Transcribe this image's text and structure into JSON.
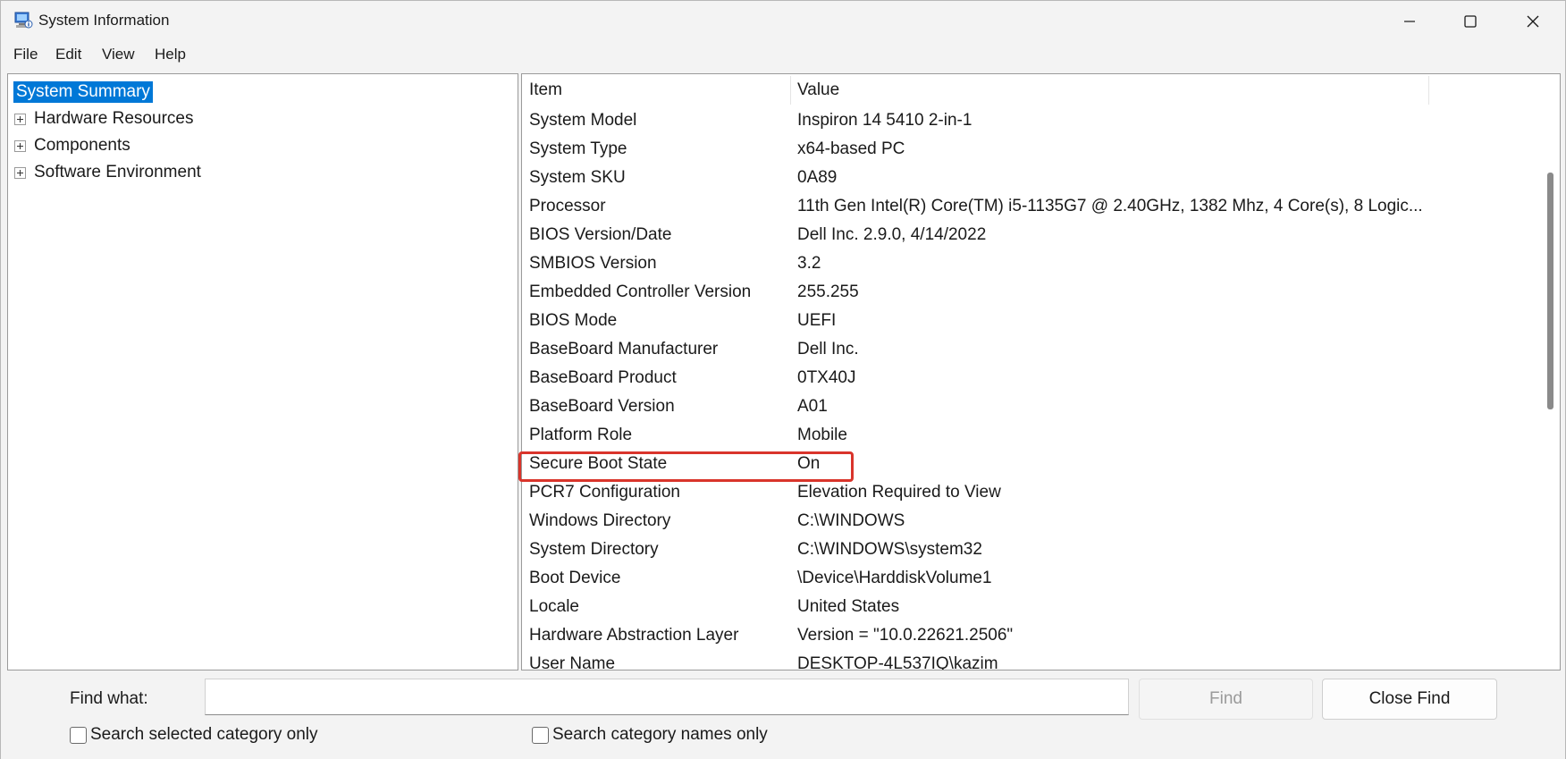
{
  "window": {
    "title": "System Information",
    "icon": "system-information-icon"
  },
  "menu": {
    "items": [
      "File",
      "Edit",
      "View",
      "Help"
    ]
  },
  "tree": {
    "items": [
      {
        "label": "System Summary",
        "selected": true,
        "expandable": false
      },
      {
        "label": "Hardware Resources",
        "selected": false,
        "expandable": true
      },
      {
        "label": "Components",
        "selected": false,
        "expandable": true
      },
      {
        "label": "Software Environment",
        "selected": false,
        "expandable": true
      }
    ]
  },
  "list": {
    "headers": {
      "item": "Item",
      "value": "Value"
    },
    "rows": [
      {
        "item": "System Model",
        "value": "Inspiron 14 5410 2-in-1"
      },
      {
        "item": "System Type",
        "value": "x64-based PC"
      },
      {
        "item": "System SKU",
        "value": "0A89"
      },
      {
        "item": "Processor",
        "value": "11th Gen Intel(R) Core(TM) i5-1135G7 @ 2.40GHz, 1382 Mhz, 4 Core(s), 8 Logic..."
      },
      {
        "item": "BIOS Version/Date",
        "value": "Dell Inc. 2.9.0, 4/14/2022"
      },
      {
        "item": "SMBIOS Version",
        "value": "3.2"
      },
      {
        "item": "Embedded Controller Version",
        "value": "255.255"
      },
      {
        "item": "BIOS Mode",
        "value": "UEFI"
      },
      {
        "item": "BaseBoard Manufacturer",
        "value": "Dell Inc."
      },
      {
        "item": "BaseBoard Product",
        "value": "0TX40J"
      },
      {
        "item": "BaseBoard Version",
        "value": "A01"
      },
      {
        "item": "Platform Role",
        "value": "Mobile"
      },
      {
        "item": "Secure Boot State",
        "value": "On"
      },
      {
        "item": "PCR7 Configuration",
        "value": "Elevation Required to View"
      },
      {
        "item": "Windows Directory",
        "value": "C:\\WINDOWS"
      },
      {
        "item": "System Directory",
        "value": "C:\\WINDOWS\\system32"
      },
      {
        "item": "Boot Device",
        "value": "\\Device\\HarddiskVolume1"
      },
      {
        "item": "Locale",
        "value": "United States"
      },
      {
        "item": "Hardware Abstraction Layer",
        "value": "Version = \"10.0.22621.2506\""
      },
      {
        "item": "User Name",
        "value": "DESKTOP-4L537IQ\\kazim"
      }
    ],
    "highlighted_item": "Secure Boot State",
    "highlight_color": "#d9342b",
    "selection_color": "#0078d7"
  },
  "find": {
    "label": "Find what:",
    "value": "",
    "find_button": "Find",
    "close_button": "Close Find",
    "check_selected": "Search selected category only",
    "check_names": "Search category names only"
  }
}
